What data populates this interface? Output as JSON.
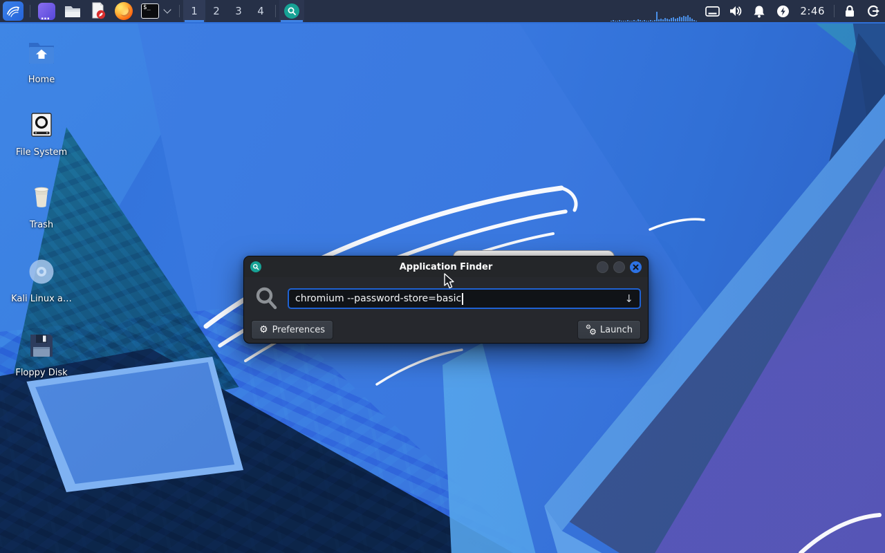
{
  "panel": {
    "workspaces": [
      "1",
      "2",
      "3",
      "4"
    ],
    "clock": "2:46",
    "terminal_glyph": "$_",
    "monitor_bars": [
      1,
      2,
      1,
      1,
      2,
      1,
      1,
      1,
      2,
      1,
      1,
      2,
      1,
      3,
      2,
      1,
      2,
      1,
      1,
      2,
      1,
      2,
      14,
      3,
      4,
      3,
      5,
      4,
      3,
      5,
      6,
      4,
      5,
      7,
      6,
      8,
      7,
      9,
      6,
      4,
      2,
      1
    ]
  },
  "desktop": {
    "icons": [
      {
        "label": "Home"
      },
      {
        "label": "File System"
      },
      {
        "label": "Trash"
      },
      {
        "label": "Kali Linux a…"
      },
      {
        "label": "Floppy Disk"
      }
    ]
  },
  "finder": {
    "title": "Application Finder",
    "search_value": "chromium --password-store=basic",
    "dropdown_glyph": "↓",
    "gear_glyph": "⚙",
    "preferences_label": "Preferences",
    "launch_label": "Launch"
  },
  "colors": {
    "panel_bg": "#263047",
    "panel_accent": "#2f6fd8",
    "dialog_bg": "#26282d",
    "input_border": "#1f62d4",
    "appfinder_teal": "#17a295",
    "close_button_blue": "#2d72e4"
  }
}
